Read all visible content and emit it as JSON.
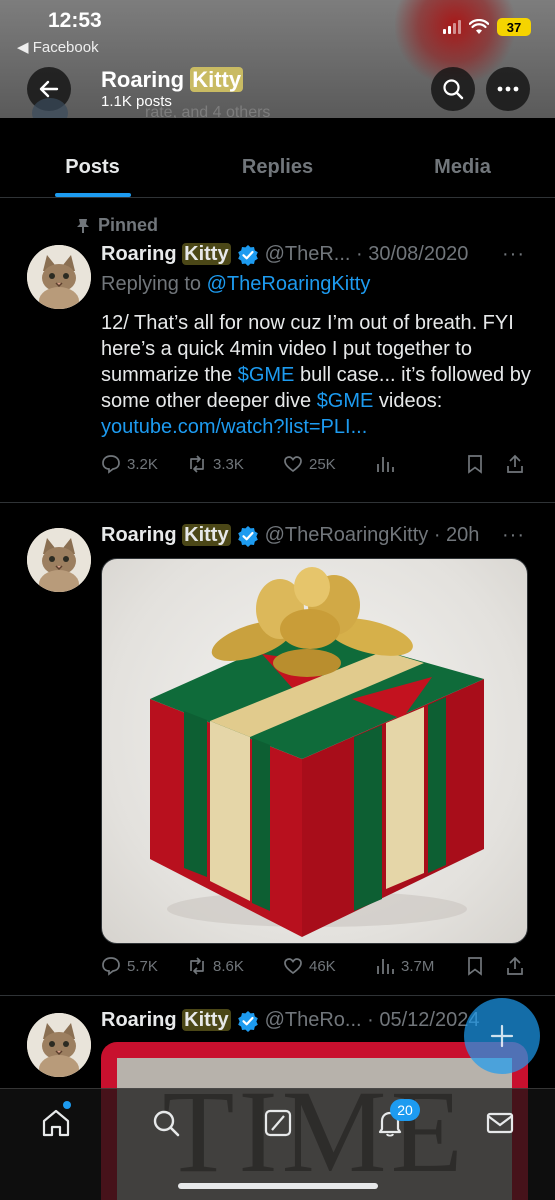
{
  "status_bar": {
    "time": "12:53",
    "back_app": "◀ Facebook",
    "battery": "37"
  },
  "header": {
    "name_part1": "Roaring ",
    "name_part2": "Kitty",
    "posts_count": "1.1K posts"
  },
  "peek_text": "rate, and 4 others",
  "tabs": [
    {
      "label": "Posts",
      "active": true
    },
    {
      "label": "Replies",
      "active": false
    },
    {
      "label": "Media",
      "active": false
    }
  ],
  "posts": [
    {
      "pinned_label": "Pinned",
      "name_part1": "Roaring ",
      "name_part2": "Kitty",
      "handle_time": "@TheR... · 30/08/2020",
      "reply_prefix": "Replying to ",
      "reply_handle": "@TheRoaringKitty",
      "text_1": "12/ That’s all for now cuz I’m out of breath. FYI here’s a quick 4min video I put together to summarize the ",
      "cashtag_1": "$GME",
      "text_2": " bull case... it’s followed by some other deeper dive ",
      "cashtag_2": "$GME",
      "text_3": " videos: ",
      "link": "youtube.com/watch?list=PLI...",
      "stats": {
        "replies": "3.2K",
        "reposts": "3.3K",
        "likes": "25K",
        "views": ""
      }
    },
    {
      "name_part1": "Roaring ",
      "name_part2": "Kitty",
      "handle_time": "@TheRoaringKitty · 20h",
      "media": "gift-box-image",
      "stats": {
        "replies": "5.7K",
        "reposts": "8.6K",
        "likes": "46K",
        "views": "3.7M"
      }
    },
    {
      "name_part1": "Roaring ",
      "name_part2": "Kitty",
      "handle_time": "@TheRo... · 05/12/2024",
      "media_text": "TIME"
    }
  ],
  "bottom_nav": {
    "notifications_badge": "20"
  },
  "colors": {
    "accent": "#1d9bf0",
    "highlight": "#c9bb63",
    "background": "#000000",
    "muted": "#71767b"
  }
}
